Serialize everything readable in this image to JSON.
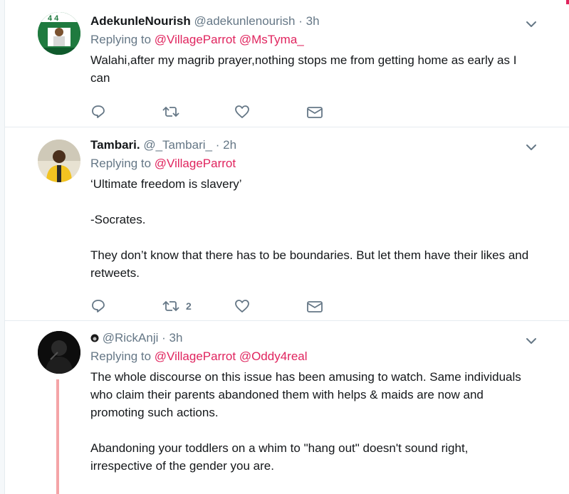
{
  "tweets": [
    {
      "name": "AdekunleNourish",
      "handle": "@adekunlenourish",
      "separator": "·",
      "time": "3h",
      "replying_prefix": "Replying to",
      "mentions": [
        "@VillageParrot",
        "@MsTyma_"
      ],
      "paragraphs": [
        "Walahi,after my magrib prayer,nothing stops me from getting home as early as I can"
      ],
      "retweet_count": "",
      "avatar_icon": "profile-photo-green"
    },
    {
      "name": "Tambari.",
      "handle": "@_Tambari_",
      "separator": "·",
      "time": "2h",
      "replying_prefix": "Replying to",
      "mentions": [
        "@VillageParrot"
      ],
      "paragraphs": [
        "‘Ultimate freedom is slavery’",
        "-Socrates.",
        "They don’t know that there has to be boundaries. But let them have their likes and retweets."
      ],
      "retweet_count": "2",
      "avatar_icon": "profile-photo-yellow"
    },
    {
      "name": "",
      "handle": "@RickAnji",
      "separator": "·",
      "time": "3h",
      "replying_prefix": "Replying to",
      "mentions": [
        "@VillageParrot",
        "@Oddy4real"
      ],
      "paragraphs": [
        "The whole discourse on this issue has been amusing to watch. Same individuals who claim their parents abandoned them with helps & maids are now and promoting such actions.",
        "Abandoning your toddlers on a whim to \"hang out\" doesn't sound right, irrespective of the gender you are."
      ],
      "retweet_count": "",
      "avatar_icon": "profile-photo-dark"
    }
  ],
  "colors": {
    "mention": "#e0245e",
    "muted": "#657786",
    "thread_line": "#f4a4a7",
    "border": "#e6ecf0"
  },
  "icons": [
    "reply-icon",
    "retweet-icon",
    "like-icon",
    "message-icon",
    "chevron-down-icon",
    "emoji-badge-icon"
  ]
}
